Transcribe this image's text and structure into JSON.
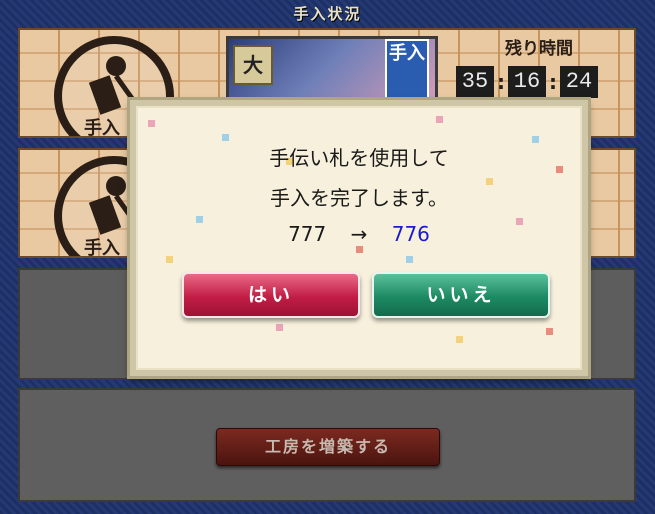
{
  "header": {
    "title": "手入状況"
  },
  "slot1": {
    "emblem_label": "手入",
    "portrait_left_badge": "大",
    "portrait_right_badge": "手入",
    "timer_label": "残り時間",
    "timer": {
      "hours": "35",
      "minutes": "16",
      "seconds": "24"
    }
  },
  "slot2": {
    "emblem_label": "手入"
  },
  "bottom": {
    "expand_label": "工房を増築する"
  },
  "dialog": {
    "line1": "手伝い札を使用して",
    "line2": "手入を完了します。",
    "count_from": "777",
    "arrow": "→",
    "count_to": "776",
    "yes_label": "はい",
    "no_label": "いいえ"
  },
  "colors": {
    "yes_button": "#c21d45",
    "no_button": "#1d8a64",
    "count_to": "#1a1ad1"
  }
}
